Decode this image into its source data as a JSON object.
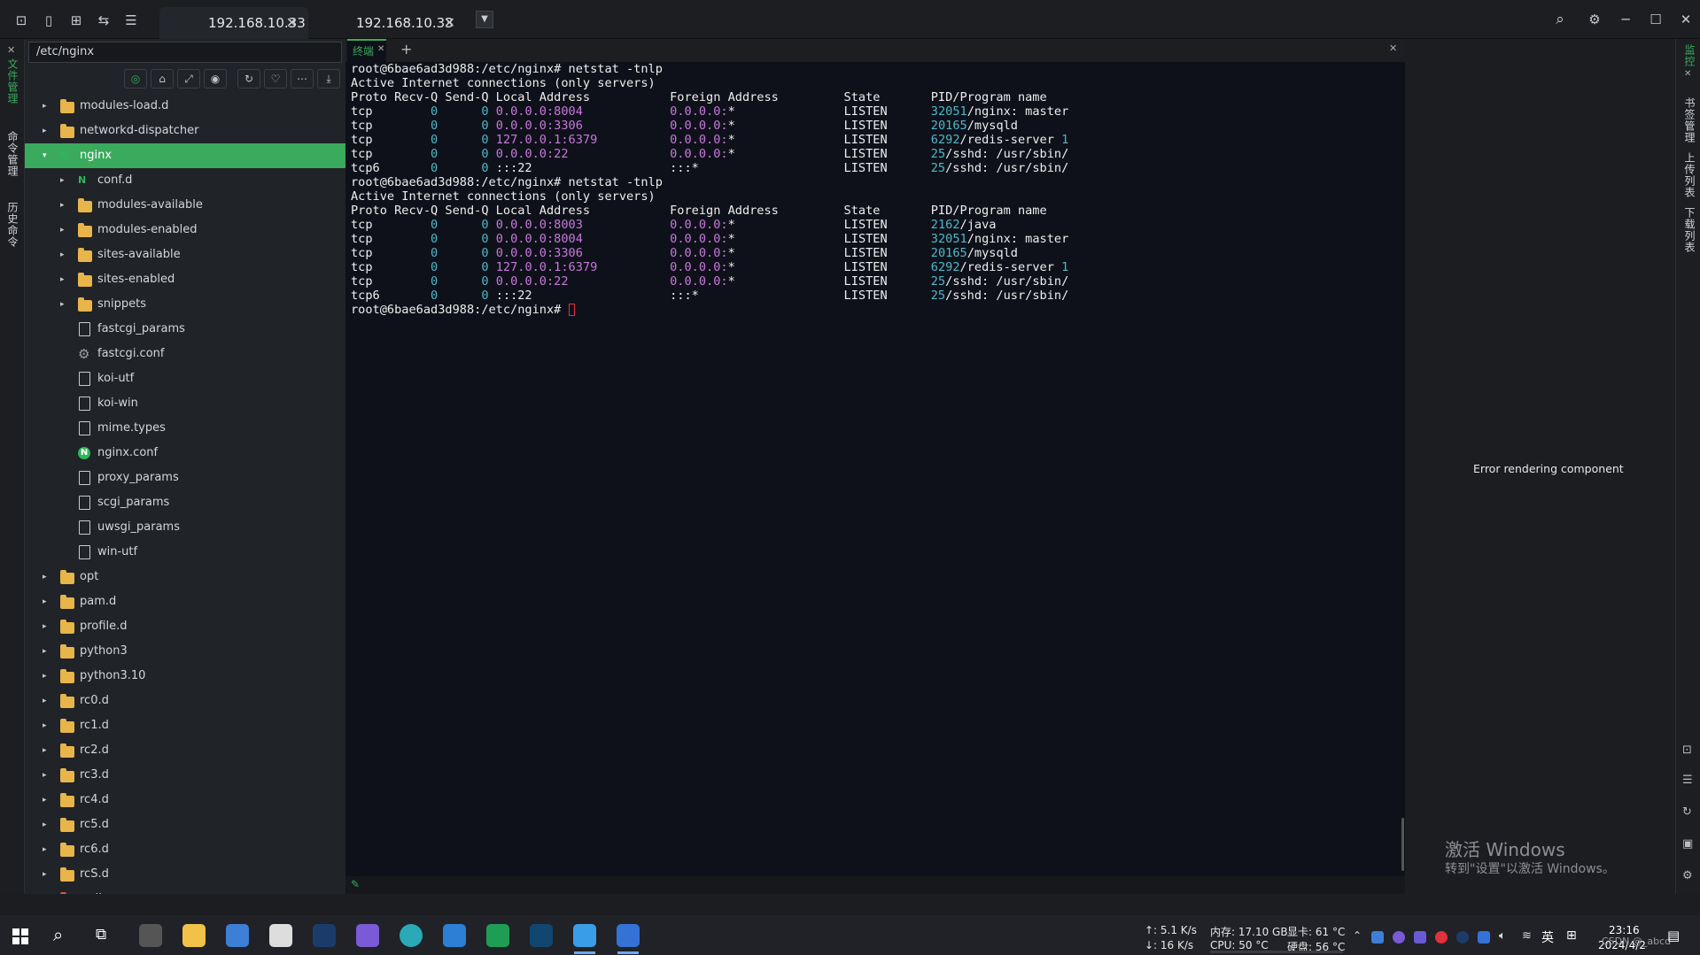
{
  "tabs": [
    {
      "title": "192.168.10.33",
      "active": true
    },
    {
      "title": "192.168.10.33",
      "active": false
    }
  ],
  "left_strip": [
    "文件管理",
    "命令管理",
    "历史命令"
  ],
  "file_tree": {
    "path": "/etc/nginx",
    "rows": [
      {
        "label": "modules-load.d",
        "type": "folder",
        "depth": 0,
        "caret": "▸"
      },
      {
        "label": "networkd-dispatcher",
        "type": "folder",
        "depth": 0,
        "caret": "▸"
      },
      {
        "label": "nginx",
        "type": "nginx-folder",
        "depth": 0,
        "caret": "▾",
        "selected": true
      },
      {
        "label": "conf.d",
        "type": "nginx-folder",
        "depth": 1,
        "caret": "▸"
      },
      {
        "label": "modules-available",
        "type": "folder",
        "depth": 1,
        "caret": "▸"
      },
      {
        "label": "modules-enabled",
        "type": "folder",
        "depth": 1,
        "caret": "▸"
      },
      {
        "label": "sites-available",
        "type": "folder",
        "depth": 1,
        "caret": "▸"
      },
      {
        "label": "sites-enabled",
        "type": "folder",
        "depth": 1,
        "caret": "▸"
      },
      {
        "label": "snippets",
        "type": "folder",
        "depth": 1,
        "caret": "▸"
      },
      {
        "label": "fastcgi_params",
        "type": "file",
        "depth": 1,
        "caret": ""
      },
      {
        "label": "fastcgi.conf",
        "type": "gear",
        "depth": 1,
        "caret": ""
      },
      {
        "label": "koi-utf",
        "type": "file",
        "depth": 1,
        "caret": ""
      },
      {
        "label": "koi-win",
        "type": "file",
        "depth": 1,
        "caret": ""
      },
      {
        "label": "mime.types",
        "type": "file",
        "depth": 1,
        "caret": ""
      },
      {
        "label": "nginx.conf",
        "type": "nginx",
        "depth": 1,
        "caret": ""
      },
      {
        "label": "proxy_params",
        "type": "file",
        "depth": 1,
        "caret": ""
      },
      {
        "label": "scgi_params",
        "type": "file",
        "depth": 1,
        "caret": ""
      },
      {
        "label": "uwsgi_params",
        "type": "file",
        "depth": 1,
        "caret": ""
      },
      {
        "label": "win-utf",
        "type": "file",
        "depth": 1,
        "caret": ""
      },
      {
        "label": "opt",
        "type": "folder",
        "depth": 0,
        "caret": "▸"
      },
      {
        "label": "pam.d",
        "type": "folder",
        "depth": 0,
        "caret": "▸"
      },
      {
        "label": "profile.d",
        "type": "folder",
        "depth": 0,
        "caret": "▸"
      },
      {
        "label": "python3",
        "type": "folder",
        "depth": 0,
        "caret": "▸"
      },
      {
        "label": "python3.10",
        "type": "folder",
        "depth": 0,
        "caret": "▸"
      },
      {
        "label": "rc0.d",
        "type": "folder",
        "depth": 0,
        "caret": "▸"
      },
      {
        "label": "rc1.d",
        "type": "folder",
        "depth": 0,
        "caret": "▸"
      },
      {
        "label": "rc2.d",
        "type": "folder",
        "depth": 0,
        "caret": "▸"
      },
      {
        "label": "rc3.d",
        "type": "folder",
        "depth": 0,
        "caret": "▸"
      },
      {
        "label": "rc4.d",
        "type": "folder",
        "depth": 0,
        "caret": "▸"
      },
      {
        "label": "rc5.d",
        "type": "folder",
        "depth": 0,
        "caret": "▸"
      },
      {
        "label": "rc6.d",
        "type": "folder",
        "depth": 0,
        "caret": "▸"
      },
      {
        "label": "rcS.d",
        "type": "folder",
        "depth": 0,
        "caret": "▸"
      },
      {
        "label": "redis",
        "type": "red-folder",
        "depth": 0,
        "caret": "▸"
      }
    ]
  },
  "terminal_tab": {
    "label": "终端"
  },
  "terminal": {
    "lines": [
      {
        "segs": [
          {
            "t": "root@6bae6ad3d988:/etc/nginx# netstat -tnlp"
          }
        ]
      },
      {
        "segs": [
          {
            "t": "Active Internet connections (only servers)"
          }
        ]
      },
      {
        "segs": [
          {
            "t": "Proto Recv-Q Send-Q Local Address           Foreign Address         State       PID/Program name"
          }
        ]
      },
      {
        "segs": [
          {
            "t": "tcp        "
          },
          {
            "t": "0",
            "c": "n"
          },
          {
            "t": "      "
          },
          {
            "t": "0",
            "c": "n"
          },
          {
            "t": " "
          },
          {
            "t": "0.0.0.0:8004",
            "c": "p"
          },
          {
            "t": "            "
          },
          {
            "t": "0.0.0.0:",
            "c": "p"
          },
          {
            "t": "*               LISTEN      "
          },
          {
            "t": "32051",
            "c": "n"
          },
          {
            "t": "/nginx: master"
          }
        ]
      },
      {
        "segs": [
          {
            "t": "tcp        "
          },
          {
            "t": "0",
            "c": "n"
          },
          {
            "t": "      "
          },
          {
            "t": "0",
            "c": "n"
          },
          {
            "t": " "
          },
          {
            "t": "0.0.0.0:3306",
            "c": "p"
          },
          {
            "t": "            "
          },
          {
            "t": "0.0.0.0:",
            "c": "p"
          },
          {
            "t": "*               LISTEN      "
          },
          {
            "t": "20165",
            "c": "n"
          },
          {
            "t": "/mysqld"
          }
        ]
      },
      {
        "segs": [
          {
            "t": "tcp        "
          },
          {
            "t": "0",
            "c": "n"
          },
          {
            "t": "      "
          },
          {
            "t": "0",
            "c": "n"
          },
          {
            "t": " "
          },
          {
            "t": "127.0.0.1:6379",
            "c": "p"
          },
          {
            "t": "          "
          },
          {
            "t": "0.0.0.0:",
            "c": "p"
          },
          {
            "t": "*               LISTEN      "
          },
          {
            "t": "6292",
            "c": "n"
          },
          {
            "t": "/redis-server "
          },
          {
            "t": "1",
            "c": "n"
          }
        ]
      },
      {
        "segs": [
          {
            "t": "tcp        "
          },
          {
            "t": "0",
            "c": "n"
          },
          {
            "t": "      "
          },
          {
            "t": "0",
            "c": "n"
          },
          {
            "t": " "
          },
          {
            "t": "0.0.0.0:22",
            "c": "p"
          },
          {
            "t": "              "
          },
          {
            "t": "0.0.0.0:",
            "c": "p"
          },
          {
            "t": "*               LISTEN      "
          },
          {
            "t": "25",
            "c": "n"
          },
          {
            "t": "/sshd: /usr/sbin/"
          }
        ]
      },
      {
        "segs": [
          {
            "t": "tcp6       "
          },
          {
            "t": "0",
            "c": "n"
          },
          {
            "t": "      "
          },
          {
            "t": "0",
            "c": "n"
          },
          {
            "t": " :::22                   :::*                    LISTEN      "
          },
          {
            "t": "25",
            "c": "n"
          },
          {
            "t": "/sshd: /usr/sbin/"
          }
        ]
      },
      {
        "segs": [
          {
            "t": "root@6bae6ad3d988:/etc/nginx# netstat -tnlp"
          }
        ]
      },
      {
        "segs": [
          {
            "t": "Active Internet connections (only servers)"
          }
        ]
      },
      {
        "segs": [
          {
            "t": "Proto Recv-Q Send-Q Local Address           Foreign Address         State       PID/Program name"
          }
        ]
      },
      {
        "segs": [
          {
            "t": "tcp        "
          },
          {
            "t": "0",
            "c": "n"
          },
          {
            "t": "      "
          },
          {
            "t": "0",
            "c": "n"
          },
          {
            "t": " "
          },
          {
            "t": "0.0.0.0:8003",
            "c": "p"
          },
          {
            "t": "            "
          },
          {
            "t": "0.0.0.0:",
            "c": "p"
          },
          {
            "t": "*               LISTEN      "
          },
          {
            "t": "2162",
            "c": "n"
          },
          {
            "t": "/java"
          }
        ]
      },
      {
        "segs": [
          {
            "t": "tcp        "
          },
          {
            "t": "0",
            "c": "n"
          },
          {
            "t": "      "
          },
          {
            "t": "0",
            "c": "n"
          },
          {
            "t": " "
          },
          {
            "t": "0.0.0.0:8004",
            "c": "p"
          },
          {
            "t": "            "
          },
          {
            "t": "0.0.0.0:",
            "c": "p"
          },
          {
            "t": "*               LISTEN      "
          },
          {
            "t": "32051",
            "c": "n"
          },
          {
            "t": "/nginx: master"
          }
        ]
      },
      {
        "segs": [
          {
            "t": "tcp        "
          },
          {
            "t": "0",
            "c": "n"
          },
          {
            "t": "      "
          },
          {
            "t": "0",
            "c": "n"
          },
          {
            "t": " "
          },
          {
            "t": "0.0.0.0:3306",
            "c": "p"
          },
          {
            "t": "            "
          },
          {
            "t": "0.0.0.0:",
            "c": "p"
          },
          {
            "t": "*               LISTEN      "
          },
          {
            "t": "20165",
            "c": "n"
          },
          {
            "t": "/mysqld"
          }
        ]
      },
      {
        "segs": [
          {
            "t": "tcp        "
          },
          {
            "t": "0",
            "c": "n"
          },
          {
            "t": "      "
          },
          {
            "t": "0",
            "c": "n"
          },
          {
            "t": " "
          },
          {
            "t": "127.0.0.1:6379",
            "c": "p"
          },
          {
            "t": "          "
          },
          {
            "t": "0.0.0.0:",
            "c": "p"
          },
          {
            "t": "*               LISTEN      "
          },
          {
            "t": "6292",
            "c": "n"
          },
          {
            "t": "/redis-server "
          },
          {
            "t": "1",
            "c": "n"
          }
        ]
      },
      {
        "segs": [
          {
            "t": "tcp        "
          },
          {
            "t": "0",
            "c": "n"
          },
          {
            "t": "      "
          },
          {
            "t": "0",
            "c": "n"
          },
          {
            "t": " "
          },
          {
            "t": "0.0.0.0:22",
            "c": "p"
          },
          {
            "t": "              "
          },
          {
            "t": "0.0.0.0:",
            "c": "p"
          },
          {
            "t": "*               LISTEN      "
          },
          {
            "t": "25",
            "c": "n"
          },
          {
            "t": "/sshd: /usr/sbin/"
          }
        ]
      },
      {
        "segs": [
          {
            "t": "tcp6       "
          },
          {
            "t": "0",
            "c": "n"
          },
          {
            "t": "      "
          },
          {
            "t": "0",
            "c": "n"
          },
          {
            "t": " :::22                   :::*                    LISTEN      "
          },
          {
            "t": "25",
            "c": "n"
          },
          {
            "t": "/sshd: /usr/sbin/"
          }
        ]
      },
      {
        "segs": [
          {
            "t": "root@6bae6ad3d988:/etc/nginx# "
          }
        ],
        "cursor": true
      }
    ]
  },
  "right_panel": {
    "error_text": "Error rendering component"
  },
  "right_strip": [
    "监控",
    "书签管理",
    "上传列表",
    "下载列表"
  ],
  "watermark": {
    "line1": "激活 Windows",
    "line2": "转到\"设置\"以激活 Windows。"
  },
  "taskbar": {
    "net_up": "↑: 5.1 K/s",
    "net_down": "↓: 16 K/s",
    "mem": "内存: 17.10 GB",
    "gpu": "显卡: 61 °C",
    "cpu": "CPU: 50 °C",
    "disk": "硬盘: 56 °C",
    "ime": "英",
    "time": "23:16",
    "date": "2024/4/2",
    "credit": "CSDN @_abcd"
  },
  "colors": {
    "accent": "#3aaa5c",
    "term_bg": "#0f111a",
    "num": "#4fb8c7",
    "addr": "#c778dd",
    "cursor": "#e0313c"
  }
}
